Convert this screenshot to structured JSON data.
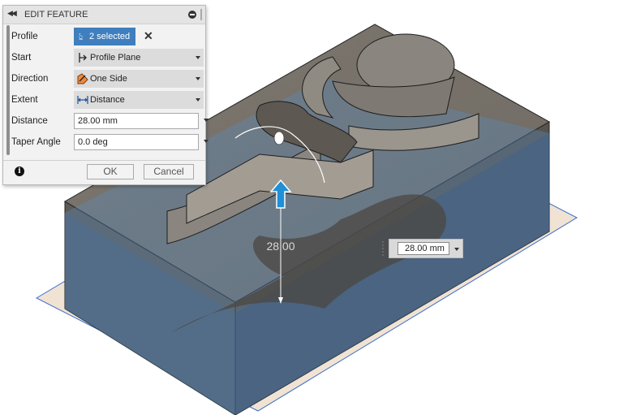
{
  "panel": {
    "title": "EDIT FEATURE",
    "profile": {
      "label": "Profile",
      "value": "2 selected"
    },
    "start": {
      "label": "Start",
      "value": "Profile Plane"
    },
    "direction": {
      "label": "Direction",
      "value": "One Side"
    },
    "extent": {
      "label": "Extent",
      "value": "Distance"
    },
    "distance": {
      "label": "Distance",
      "value": "28.00 mm"
    },
    "taper": {
      "label": "Taper Angle",
      "value": "0.0 deg"
    },
    "ok_label": "OK",
    "cancel_label": "Cancel"
  },
  "canvas": {
    "dimension_label": "28.00",
    "distance_input_value": "28.00 mm"
  },
  "colors": {
    "selection_blue": "#3f7fbf",
    "body_gray": "#6f6a64",
    "preview_blue": "#4a7db3",
    "arrow_blue": "#1f8fd6"
  }
}
